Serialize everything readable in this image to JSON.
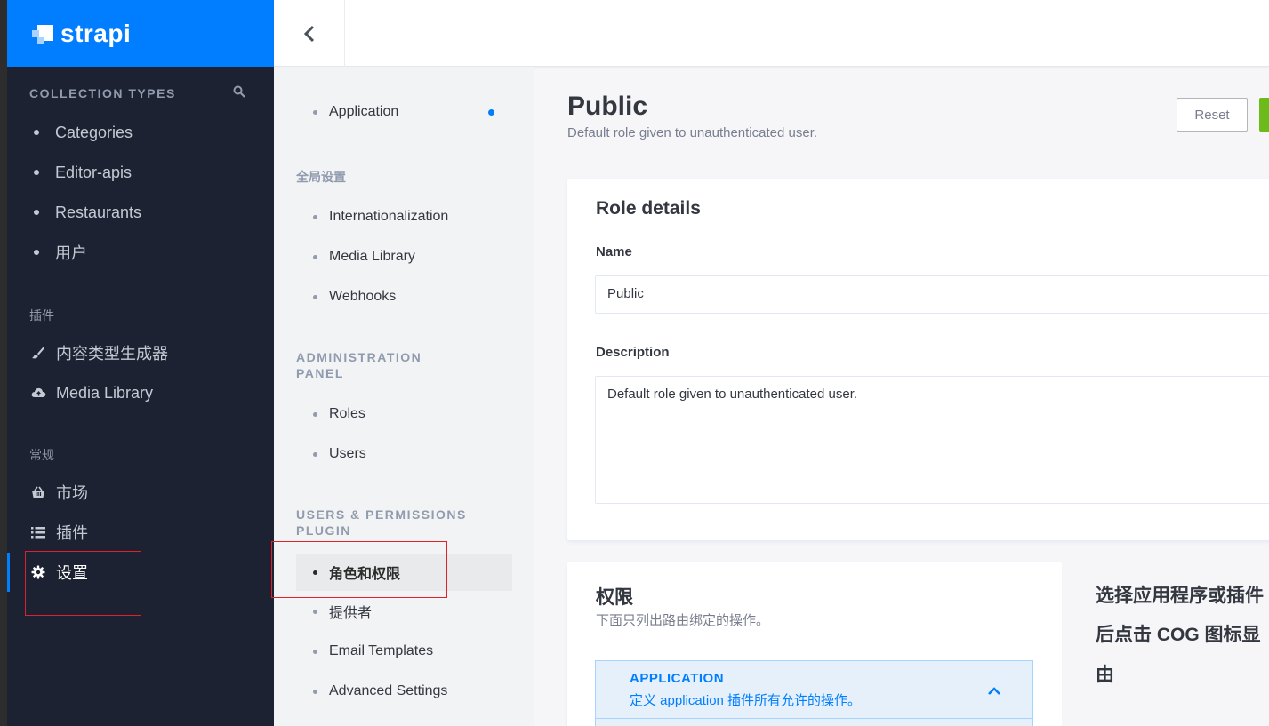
{
  "brand": {
    "name": "strapi"
  },
  "sidebar": {
    "collection_types_heading": "COLLECTION TYPES",
    "collection_types": [
      "Categories",
      "Editor-apis",
      "Restaurants",
      "用户"
    ],
    "plugins_heading": "插件",
    "plugins": [
      {
        "label": "内容类型生成器",
        "icon": "brush-icon"
      },
      {
        "label": "Media Library",
        "icon": "cloud-upload-icon"
      }
    ],
    "general_heading": "常规",
    "general": [
      {
        "label": "市场",
        "icon": "shopping-basket-icon"
      },
      {
        "label": "插件",
        "icon": "list-icon"
      },
      {
        "label": "设置",
        "icon": "gear-icon"
      }
    ]
  },
  "submenu": {
    "top_item": "Application",
    "global_heading": "全局设置",
    "global_items": [
      "Internationalization",
      "Media Library",
      "Webhooks"
    ],
    "admin_heading_1": "ADMINISTRATION",
    "admin_heading_2": "PANEL",
    "admin_items": [
      "Roles",
      "Users"
    ],
    "up_heading_1": "USERS & PERMISSIONS",
    "up_heading_2": "PLUGIN",
    "up_items": [
      "角色和权限",
      "提供者",
      "Email Templates",
      "Advanced Settings"
    ]
  },
  "main": {
    "title": "Public",
    "subtitle": "Default role given to unauthenticated user.",
    "reset_label": "Reset",
    "role_details": {
      "title": "Role details",
      "name_label": "Name",
      "name_value": "Public",
      "description_label": "Description",
      "description_value": "Default role given to unauthenticated user."
    },
    "permissions": {
      "title": "权限",
      "subtitle": "下面只列出路由绑定的操作。",
      "accordion_title": "APPLICATION",
      "accordion_desc": "定义 application 插件所有允许的操作。"
    },
    "right_panel": {
      "line1": "选择应用程序或插件",
      "line2": "后点击 COG 图标显",
      "line3": "由"
    }
  },
  "colors": {
    "brand_blue": "#007eff",
    "sidebar_bg": "#1d2232",
    "save_green": "#6dbb1a",
    "highlight_red": "#e0202b"
  }
}
